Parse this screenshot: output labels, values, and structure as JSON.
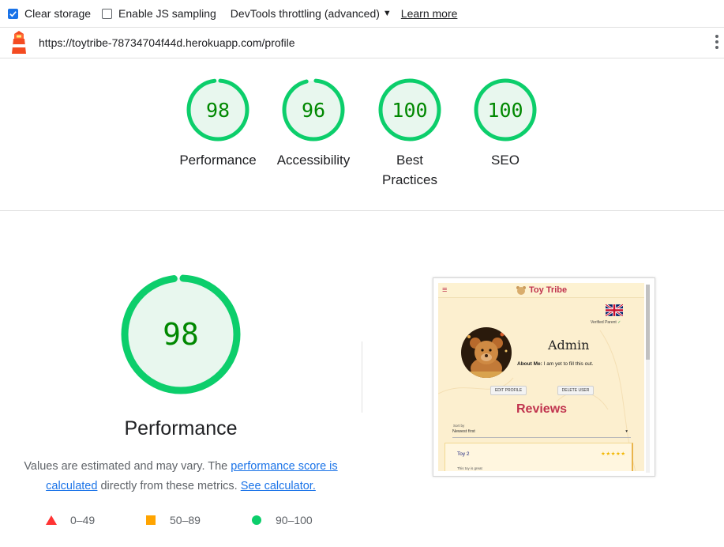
{
  "toolbar": {
    "clear_storage": {
      "label": "Clear storage",
      "checked": true
    },
    "enable_js_sampling": {
      "label": "Enable JS sampling",
      "checked": false
    },
    "throttling_label": "DevTools throttling (advanced)",
    "learn_more": "Learn more"
  },
  "url_bar": {
    "url": "https://toytribe-78734704f44d.herokuapp.com/profile",
    "logo_icon": "lighthouse-icon",
    "menu_icon": "kebab-menu-icon"
  },
  "scores": [
    {
      "score": 98,
      "label": "Performance",
      "fraction": 0.98
    },
    {
      "score": 96,
      "label": "Accessibility",
      "fraction": 0.96
    },
    {
      "score": 100,
      "label": "Best Practices",
      "fraction": 1.0
    },
    {
      "score": 100,
      "label": "SEO",
      "fraction": 1.0
    }
  ],
  "colors": {
    "pass": "#0cce6b",
    "pass_text": "#008800",
    "pass_fill": "#e8f7ee",
    "average": "#ffa400",
    "fail": "#ff3333",
    "link": "#1a73e8"
  },
  "performance": {
    "score": 98,
    "fraction": 0.98,
    "title": "Performance",
    "desc_part1": "Values are estimated and may vary. The ",
    "desc_link1": "performance score is calculated",
    "desc_part2": " directly from these metrics. ",
    "desc_link2": "See calculator."
  },
  "legend": [
    {
      "shape": "triangle",
      "range": "0–49"
    },
    {
      "shape": "square",
      "range": "50–89"
    },
    {
      "shape": "circle",
      "range": "90–100"
    }
  ],
  "screenshot": {
    "brand": "Toy Tribe",
    "verified": "Verified Parent",
    "name": "Admin",
    "about_label": "About Me:",
    "about_text": "I am yet to fill this out.",
    "edit_button": "EDIT PROFILE",
    "delete_button": "DELETE USER",
    "reviews_heading": "Reviews",
    "sort_label": "Sort by",
    "sort_value": "Newest first",
    "review_title": "Toy 2",
    "review_stars": "★★★★★",
    "review_sub": "This toy is great"
  }
}
